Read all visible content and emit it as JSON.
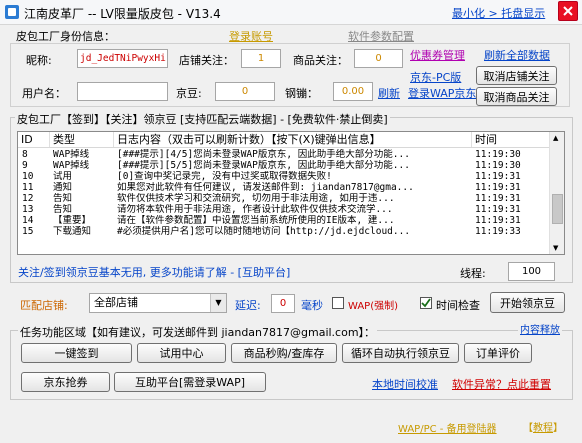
{
  "window": {
    "title": "江南皮革厂  --  LV限量版皮包 - V13.4",
    "minimize_tray": "最小化 > 托盘显示"
  },
  "identity": {
    "group_title": "皮包工厂身份信息：",
    "login_link": "登录账号",
    "params_link": "软件参数配置",
    "nickname_label": "昵称:",
    "nickname_value": "jd_JedTNiPwyxHi",
    "shop_follow_label": "店铺关注：",
    "shop_follow_value": "1",
    "goods_follow_label": "商品关注：",
    "goods_follow_value": "0",
    "coupon_link": "优惠券管理",
    "refresh_all_link": "刷新全部数据",
    "username_label": "用户名：",
    "username_value": "",
    "jingdou_label": "京豆:",
    "jingdou_value": "0",
    "gangbeng_label": "钢镚：",
    "gangbeng_value": "0.00",
    "refresh_link": "刷新",
    "jd_pc_link": "京东-PC版",
    "wap_login_link": "登录WAP京东",
    "cancel_shop_button": "取消店铺关注",
    "cancel_goods_button": "取消商品关注"
  },
  "log": {
    "group_title": "皮包工厂【签到】【关注】领京豆 [支持匹配云端数据] - [免费软件·禁止倒卖]",
    "columns": [
      "ID",
      "类型",
      "日志内容（双击可以刷新计数）【按下(X)键弹出信息】",
      "时间"
    ],
    "rows": [
      {
        "id": "8",
        "type": "WAP掉线",
        "content": "[###提示][4/5]您尚未登录WAP版京东, 因此助手绝大部分功能...",
        "time": "11:19:30"
      },
      {
        "id": "9",
        "type": "WAP掉线",
        "content": "[###提示][5/5]您尚未登录WAP版京东, 因此助手绝大部分功能...",
        "time": "11:19:30"
      },
      {
        "id": "10",
        "type": "试用",
        "content": "[0]查询中奖记录完, 没有中过奖或取得数据失败!",
        "time": "11:19:31"
      },
      {
        "id": "11",
        "type": "通知",
        "content": "如果您对此软件有任何建议, 请发送邮件到: jiandan7817@gma...",
        "time": "11:19:31"
      },
      {
        "id": "12",
        "type": "告知",
        "content": "软件仅供技术学习和交流研究, 切勿用于非法用途, 如用于违...",
        "time": "11:19:31"
      },
      {
        "id": "13",
        "type": "告知",
        "content": "请勿将本软件用于非法用途, 作者设计此软件仅供技术交流学...",
        "time": "11:19:31"
      },
      {
        "id": "14",
        "type": "【重要】",
        "content": "请在【软件参数配置】中设置您当前系统所使用的IE版本, 建...",
        "time": "11:19:31"
      },
      {
        "id": "15",
        "type": "下载通知",
        "content": "#必须提供用户名]您可以随时随地访问【http://jd.ejdcloud...",
        "time": "11:19:33"
      }
    ],
    "info_text": "关注/签到领京豆基本无用, 更多功能请了解 - [互助平台]",
    "threads_label": "线程:",
    "threads_value": "100"
  },
  "match": {
    "shop_label": "匹配店铺:",
    "shop_select": "全部店铺",
    "delay_label": "延迟:",
    "delay_value": "0",
    "ms_label": "毫秒",
    "wap_force_label": "WAP(强制)",
    "wap_force_checked": false,
    "time_check_label": "时间检查",
    "time_check_checked": true,
    "start_button": "开始领京豆"
  },
  "tasks": {
    "group_title": "任务功能区域【如有建议，可发送邮件到 jiandan7817@gmail.com】：",
    "help_link": "内容释放",
    "buttons_row1": [
      "一键签到",
      "试用中心",
      "商品秒购/查库存",
      "循环自动执行领京豆",
      "订单评价"
    ],
    "buttons_row2": [
      "京东抢券",
      "互助平台[需登录WAP]"
    ],
    "local_time_link": "本地时间校准",
    "abnormal_link": "软件异常？点此重置",
    "footer_link": "WAP/PC - 备用登陆器",
    "tutorial_link": "教程"
  },
  "colors": {
    "link_blue": "#0645c9",
    "gold": "#c79a00",
    "red": "#d00000",
    "field_red": "#cc0000"
  }
}
